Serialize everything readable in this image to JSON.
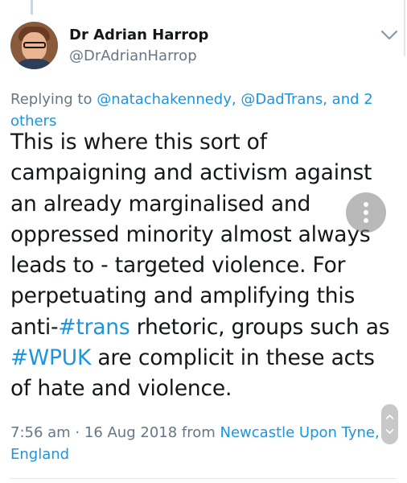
{
  "author": {
    "display_name": "Dr Adrian Harrop",
    "handle": "@DrAdrianHarrop"
  },
  "reply_context": {
    "prefix": "Replying to ",
    "mentions": "@natachakennedy, @DadTrans, and 2 others"
  },
  "tweet": {
    "text_part1": "This is where this sort of campaigning and activism against an already marginalised and oppressed minority almost always leads to - targeted violence. For perpetuating and amplifying this anti-",
    "hashtag_trans": "#trans",
    "text_part2": " rhetoric, groups such as ",
    "hashtag_wpuk": "#WPUK",
    "text_part3": " are complicit in these acts of hate and violence."
  },
  "meta": {
    "timestamp": "7:56 am · 16 Aug 2018 from ",
    "location": "Newcastle Upon Tyne, England"
  },
  "icons": {
    "chevron": "chevron-down-icon",
    "more": "more-vertical-icon",
    "scroll_up": "scroll-up-icon",
    "scroll_down": "scroll-down-icon"
  },
  "colors": {
    "link": "#1b95e0",
    "secondary_text": "#657786",
    "primary_text": "#14171a"
  }
}
